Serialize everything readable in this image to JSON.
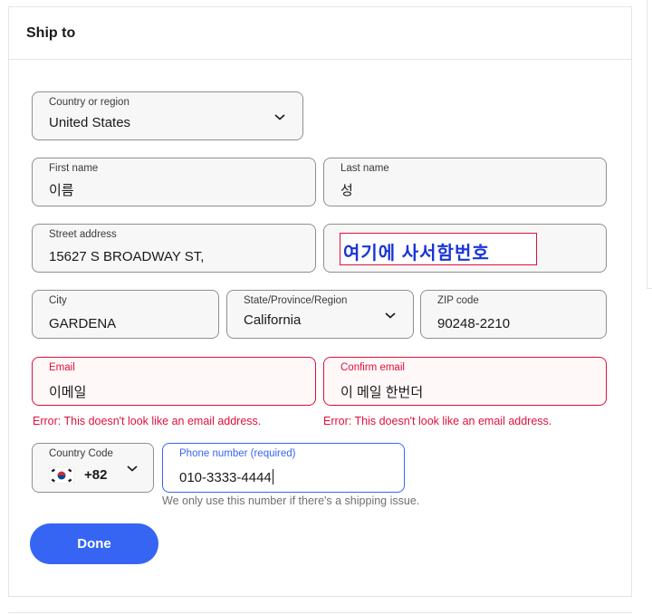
{
  "header": {
    "title": "Ship to"
  },
  "country": {
    "label": "Country or region",
    "value": "United States"
  },
  "first_name": {
    "label": "First name",
    "value": "이름"
  },
  "last_name": {
    "label": "Last name",
    "value": "성"
  },
  "street": {
    "label": "Street address",
    "value": "15627 S BROADWAY ST,"
  },
  "street2_annotation": "여기에 사서함번호",
  "city": {
    "label": "City",
    "value": "GARDENA"
  },
  "state": {
    "label": "State/Province/Region",
    "value": "California"
  },
  "zip": {
    "label": "ZIP code",
    "value": "90248-2210"
  },
  "email": {
    "label": "Email",
    "value": "이메일",
    "error": "Error: This doesn't look like an email address."
  },
  "confirm_email": {
    "label": "Confirm email",
    "value": "이 메일 한번더",
    "error": "Error: This doesn't look like an email address."
  },
  "country_code": {
    "label": "Country Code",
    "value": "+82",
    "flag": "south-korea-flag-icon"
  },
  "phone": {
    "label": "Phone number (required)",
    "value": "010-3333-4444",
    "help": "We only use this number if there's a shipping issue."
  },
  "done_label": "Done",
  "colors": {
    "accent": "#3665f3",
    "error": "#e0103a",
    "annotation_text": "#1a35d6"
  }
}
